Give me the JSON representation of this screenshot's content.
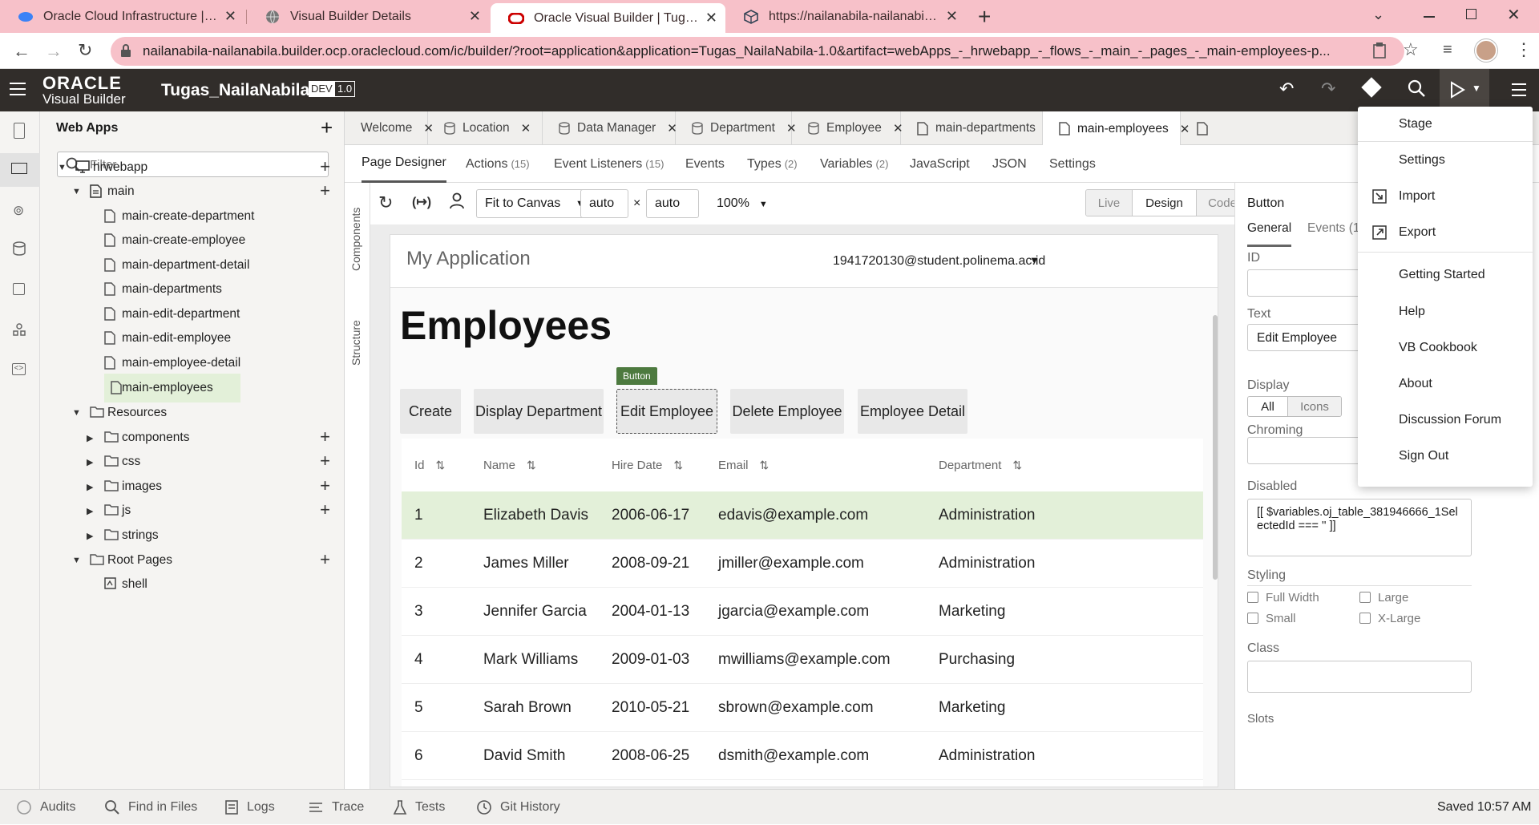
{
  "browser": {
    "tabs": [
      {
        "title": "Oracle Cloud Infrastructure | Sign",
        "icon": "oracle-cloud-icon"
      },
      {
        "title": "Visual Builder Details",
        "icon": "globe-icon"
      },
      {
        "title": "Oracle Visual Builder | Tugas_Nai",
        "icon": "oracle-icon",
        "active": true
      },
      {
        "title": "https://nailanabila-nailanabila.bu",
        "icon": "cube-icon"
      }
    ],
    "new_tab": "+",
    "url": "nailanabila-nailanabila.builder.ocp.oraclecloud.com/ic/builder/?root=application&application=Tugas_NailaNabila-1.0&artifact=webApps_-_hrwebapp_-_flows_-_main_-_pages_-_main-employees-p..."
  },
  "header": {
    "brand_top": "ORACLE",
    "brand_bottom": "Visual Builder",
    "app_name": "Tugas_NailaNabila",
    "badge_dev": "DEV",
    "badge_version": "1.0"
  },
  "nav": {
    "title": "Web Apps",
    "filter_placeholder": "Filter",
    "tree": [
      {
        "label": "hrwebapp",
        "level": 1,
        "type": "webapp",
        "expand": "open",
        "plus": true
      },
      {
        "label": "main",
        "level": 2,
        "type": "flow",
        "expand": "open",
        "plus": true
      },
      {
        "label": "main-create-department",
        "level": 3,
        "type": "page"
      },
      {
        "label": "main-create-employee",
        "level": 3,
        "type": "page"
      },
      {
        "label": "main-department-detail",
        "level": 3,
        "type": "page"
      },
      {
        "label": "main-departments",
        "level": 3,
        "type": "page"
      },
      {
        "label": "main-edit-department",
        "level": 3,
        "type": "page"
      },
      {
        "label": "main-edit-employee",
        "level": 3,
        "type": "page"
      },
      {
        "label": "main-employee-detail",
        "level": 3,
        "type": "page"
      },
      {
        "label": "main-employees",
        "level": 3,
        "type": "page",
        "selected": true
      },
      {
        "label": "Resources",
        "level": 2,
        "type": "folder",
        "expand": "open"
      },
      {
        "label": "components",
        "level": 3,
        "type": "folder",
        "expand": "closed",
        "plus": true
      },
      {
        "label": "css",
        "level": 3,
        "type": "folder",
        "expand": "closed",
        "plus": true
      },
      {
        "label": "images",
        "level": 3,
        "type": "folder",
        "expand": "closed",
        "plus": true
      },
      {
        "label": "js",
        "level": 3,
        "type": "folder",
        "expand": "closed",
        "plus": true
      },
      {
        "label": "strings",
        "level": 3,
        "type": "folder",
        "expand": "closed"
      },
      {
        "label": "Root Pages",
        "level": 2,
        "type": "folder",
        "expand": "open",
        "plus": true
      },
      {
        "label": "shell",
        "level": 3,
        "type": "shell"
      }
    ]
  },
  "editor_tabs": [
    {
      "label": "Welcome",
      "icon": ""
    },
    {
      "label": "Location",
      "icon": "database-icon"
    },
    {
      "label": "Data Manager",
      "icon": "database-icon"
    },
    {
      "label": "Department",
      "icon": "database-icon"
    },
    {
      "label": "Employee",
      "icon": "database-icon"
    },
    {
      "label": "main-departments",
      "icon": "page-icon"
    },
    {
      "label": "main-employees",
      "icon": "page-icon",
      "active": true
    }
  ],
  "sub_tabs": [
    {
      "label": "Page Designer",
      "count": "",
      "active": true
    },
    {
      "label": "Actions",
      "count": "(15)"
    },
    {
      "label": "Event Listeners",
      "count": "(15)"
    },
    {
      "label": "Events",
      "count": ""
    },
    {
      "label": "Types",
      "count": "(2)"
    },
    {
      "label": "Variables",
      "count": "(2)"
    },
    {
      "label": "JavaScript",
      "count": ""
    },
    {
      "label": "JSON",
      "count": ""
    },
    {
      "label": "Settings",
      "count": ""
    }
  ],
  "side_strip": {
    "components": "Components",
    "structure": "Structure"
  },
  "toolbar": {
    "fit": "Fit to Canvas",
    "width": "auto",
    "times": "×",
    "height": "auto",
    "zoom": "100%",
    "modes": [
      "Live",
      "Design",
      "Code"
    ],
    "active_mode": "Design"
  },
  "app_page": {
    "app_title": "My Application",
    "user": "1941720130@student.polinema.ac.id",
    "heading": "Employees",
    "selected_tag": "Button",
    "buttons": [
      "Create",
      "Display Department",
      "Edit Employee",
      "Delete Employee",
      "Employee Detail"
    ],
    "columns": [
      "Id",
      "Name",
      "Hire Date",
      "Email",
      "Department"
    ],
    "rows": [
      [
        "1",
        "Elizabeth Davis",
        "2006-06-17",
        "edavis@example.com",
        "Administration"
      ],
      [
        "2",
        "James Miller",
        "2008-09-21",
        "jmiller@example.com",
        "Administration"
      ],
      [
        "3",
        "Jennifer Garcia",
        "2004-01-13",
        "jgarcia@example.com",
        "Marketing"
      ],
      [
        "4",
        "Mark Williams",
        "2009-01-03",
        "mwilliams@example.com",
        "Purchasing"
      ],
      [
        "5",
        "Sarah Brown",
        "2010-05-21",
        "sbrown@example.com",
        "Marketing"
      ],
      [
        "6",
        "David Smith",
        "2008-06-25",
        "dsmith@example.com",
        "Administration"
      ]
    ]
  },
  "props": {
    "title": "Button",
    "tab_general": "General",
    "tab_events": "Events (1",
    "id_label": "ID",
    "id_value": "",
    "text_label": "Text",
    "text_value": "Edit Employee",
    "display_label": "Display",
    "display_all": "All",
    "display_icons": "Icons",
    "chroming_label": "Chroming",
    "disabled_label": "Disabled",
    "disabled_value": "[[ $variables.oj_table_381946666_1SelectedId === '' ]]",
    "styling_label": "Styling",
    "styles": [
      "Full Width",
      "Large",
      "Small",
      "X-Large"
    ],
    "class_label": "Class",
    "slots_label": "Slots"
  },
  "menu": {
    "items": [
      {
        "label": "Stage",
        "icon": ""
      },
      {
        "label": "Settings",
        "icon": ""
      },
      {
        "label": "Import",
        "icon": "import-icon"
      },
      {
        "label": "Export",
        "icon": "export-icon"
      },
      {
        "label": "Getting Started",
        "icon": ""
      },
      {
        "label": "Help",
        "icon": ""
      },
      {
        "label": "VB Cookbook",
        "icon": ""
      },
      {
        "label": "About",
        "icon": ""
      },
      {
        "label": "Discussion Forum",
        "icon": ""
      },
      {
        "label": "Sign Out",
        "icon": ""
      }
    ]
  },
  "status": {
    "items": [
      "Audits",
      "Find in Files",
      "Logs",
      "Trace",
      "Tests",
      "Git History"
    ],
    "saved": "Saved 10:57 AM"
  },
  "colors": {
    "tabbar": "#f7c1c9",
    "header": "#312d2a",
    "selected_row": "#e3f0d9",
    "tag": "#4d7a3f"
  }
}
